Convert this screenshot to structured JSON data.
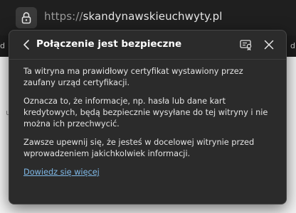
{
  "address_bar": {
    "url_prefix": "https://",
    "url_domain": "skandynawskieuchwyty.pl",
    "lock_icon": "lock-icon"
  },
  "background": {
    "left_fragment": "d",
    "right_fragment": "d",
    "page_fragment": "u"
  },
  "popup": {
    "title": "Połączenie jest bezpieczne",
    "icons": [
      "chevron-left-icon",
      "certificate-icon",
      "close-icon"
    ],
    "paragraphs": [
      "Ta witryna ma prawidłowy certyfikat wystawiony przez zaufany urząd certyfikacji.",
      "Oznacza to, że informacje, np. hasła lub dane kart kredytowych, będą bezpiecznie wysyłane do tej witryny i nie można ich przechwycić.",
      "Zawsze upewnij się, że jesteś w docelowej witrynie przed wprowadzeniem jakichkolwiek informacji."
    ],
    "learn_more": "Dowiedz się więcej"
  }
}
